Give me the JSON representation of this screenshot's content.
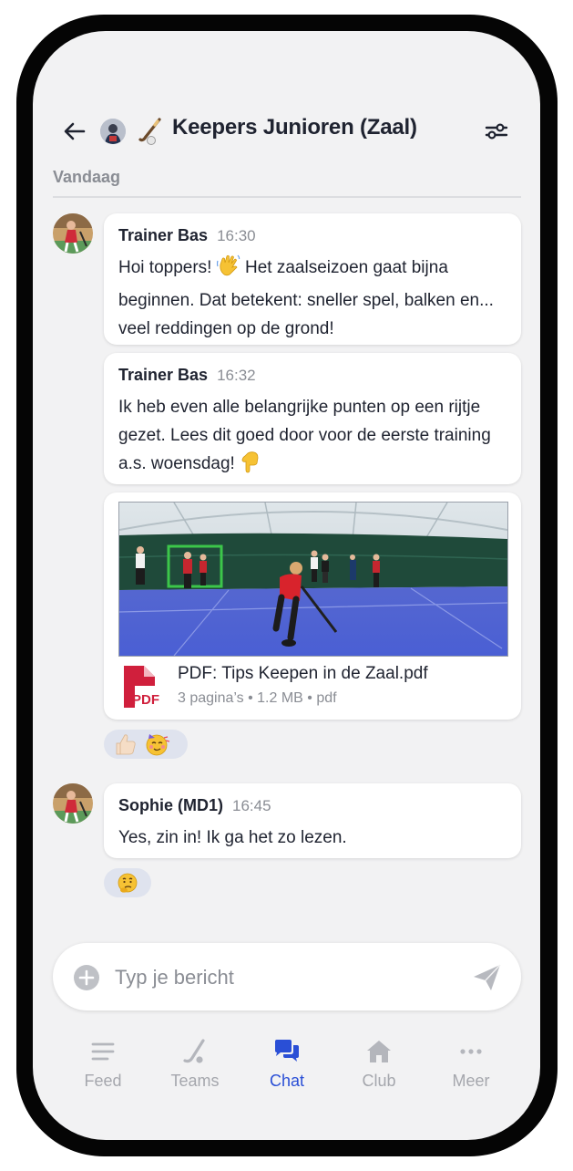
{
  "header": {
    "title": "Keepers Junioren (Zaal)"
  },
  "date_label": "Vandaag",
  "messages": [
    {
      "sender": "Trainer Bas",
      "time": "16:30",
      "text_a": "Hoi toppers! ",
      "text_b": " Het zaalseizoen gaat bijna beginnen. Dat betekent: sneller spel, balken en... veel reddingen op de grond!"
    },
    {
      "sender": "Trainer Bas",
      "time": "16:32",
      "text_a": "Ik heb even alle belangrijke punten op een rijtje gezet. Lees dit goed door voor de eerste training a.s. woensdag! "
    },
    {
      "sender": "Sophie (MD1)",
      "time": "16:45",
      "text_a": "Yes, zin in! Ik ga het zo lezen."
    }
  ],
  "attachment": {
    "icon_label": "PDF",
    "name": "PDF: Tips Keepen in de Zaal.pdf",
    "meta": "3 pagina’s • 1.2 MB • pdf"
  },
  "composer": {
    "placeholder": "Typ je bericht"
  },
  "nav": {
    "items": [
      {
        "label": "Feed",
        "icon": "menu-lines-icon"
      },
      {
        "label": "Teams",
        "icon": "hockey-stick-icon"
      },
      {
        "label": "Chat",
        "icon": "chat-bubbles-icon"
      },
      {
        "label": "Club",
        "icon": "home-icon"
      },
      {
        "label": "Meer",
        "icon": "more-dots-icon"
      }
    ],
    "active": "Chat"
  },
  "colors": {
    "accent": "#2a4fd6",
    "pdf_red": "#d01f3c",
    "muted": "#8a8d94",
    "background": "#f2f2f3"
  }
}
